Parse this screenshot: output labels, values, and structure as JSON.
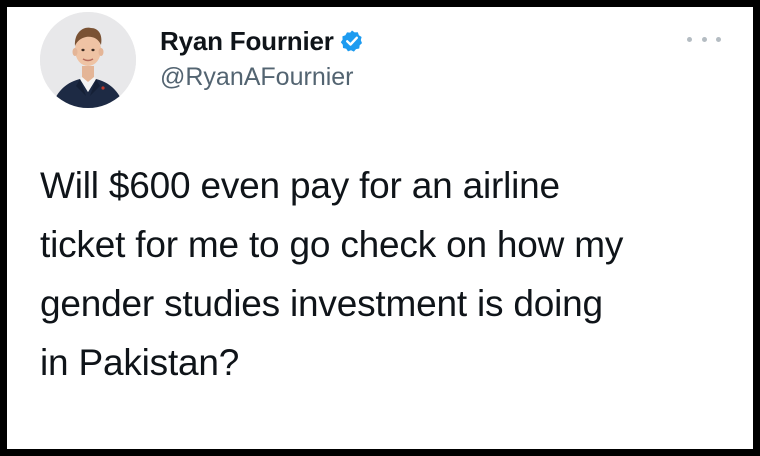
{
  "tweet": {
    "author": {
      "display_name": "Ryan Fournier",
      "handle": "@RyanAFournier",
      "verified": true,
      "verified_icon": "verified-badge-icon",
      "avatar_icon": "profile-photo"
    },
    "more_menu_icon": "more-options-icon",
    "text_lines": [
      "Will $600 even pay for an airline",
      "ticket for me to go check on how my",
      "gender studies investment is doing",
      "in Pakistan?"
    ]
  },
  "colors": {
    "background": "#ffffff",
    "border": "#000000",
    "primary_text": "#0f1419",
    "secondary_text": "#536471",
    "verified_blue": "#1d9bf0"
  }
}
